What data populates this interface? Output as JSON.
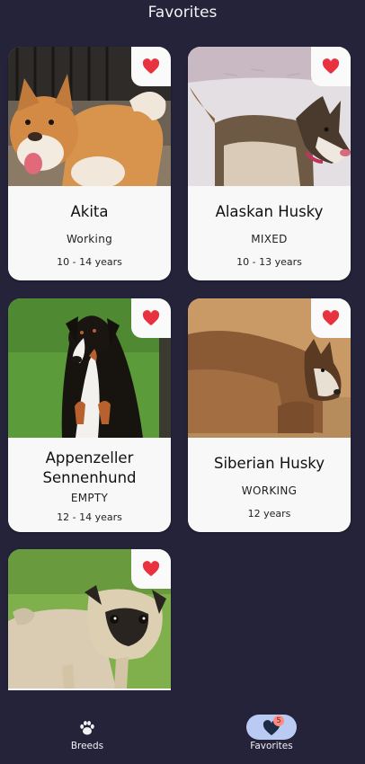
{
  "header": {
    "title": "Favorites"
  },
  "cards": [
    {
      "name": "Akita",
      "group": "Working",
      "life_span": "10 - 14 years",
      "favorite": true,
      "icon": "heart-icon"
    },
    {
      "name": "Alaskan Husky",
      "group": "MIXED",
      "life_span": "10 - 13 years",
      "favorite": true,
      "icon": "heart-icon"
    },
    {
      "name": "Appenzeller Sennenhund",
      "group": "EMPTY",
      "life_span": "12 - 14 years",
      "favorite": true,
      "icon": "heart-icon"
    },
    {
      "name": "Siberian Husky",
      "group": "WORKING",
      "life_span": "12 years",
      "favorite": true,
      "icon": "heart-icon"
    },
    {
      "name": "",
      "group": "",
      "life_span": "",
      "favorite": true,
      "icon": "heart-icon"
    }
  ],
  "nav": {
    "items": [
      {
        "label": "Breeds",
        "icon": "paw-icon",
        "selected": false
      },
      {
        "label": "Favorites",
        "icon": "heart-icon",
        "selected": true,
        "badge": "5"
      }
    ]
  },
  "colors": {
    "background": "#25233a",
    "heart": "#e8323f",
    "card": "#f8f8f8",
    "selected_pill": "#b9cbf2"
  }
}
